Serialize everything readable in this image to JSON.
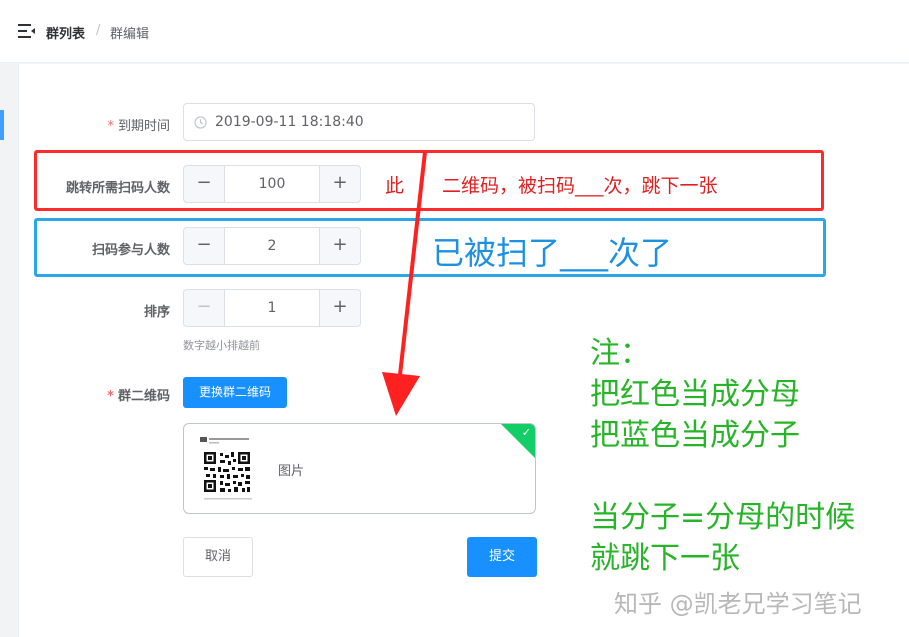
{
  "breadcrumb": {
    "item1": "群列表",
    "separator": "/",
    "item2": "群编辑"
  },
  "form": {
    "expire_label": "到期时间",
    "expire_value": "2019-09-11 18:18:40",
    "jump_label": "跳转所需扫码人数",
    "jump_value": "100",
    "scan_label": "扫码参与人数",
    "scan_value": "2",
    "sort_label": "排序",
    "sort_value": "1",
    "sort_hint": "数字越小排越前",
    "qr_label": "群二维码",
    "qr_change_btn": "更换群二维码",
    "image_label": "图片",
    "cancel_btn": "取消",
    "submit_btn": "提交",
    "required_mark": "*",
    "minus_symbol": "−",
    "plus_symbol": "+"
  },
  "annotations": {
    "red_left": "此",
    "red_right": "二维码，被扫码___次，跳下一张",
    "blue_text": "已被扫了___次了",
    "note_lines": [
      "注：",
      "把红色当成分母",
      "把蓝色当成分子",
      "",
      "当分子=分母的时候",
      "就跳下一张"
    ]
  },
  "watermark": "知乎 @凯老兄学习笔记",
  "colors": {
    "primary": "#1890ff",
    "success": "#13ce66",
    "annotation_red": "#ff2a2a",
    "annotation_blue": "#2aa6ea",
    "annotation_green": "#28b428"
  }
}
